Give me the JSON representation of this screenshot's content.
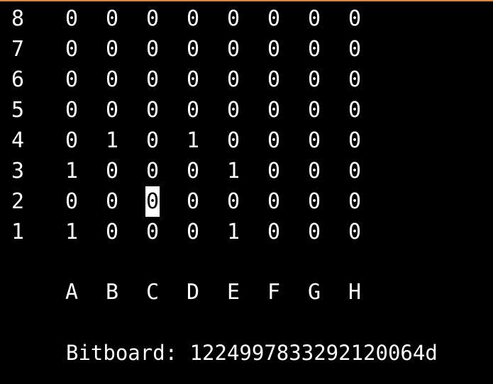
{
  "terminal": {
    "rows": [
      {
        "rank": "8",
        "cells": [
          "0",
          "0",
          "0",
          "0",
          "0",
          "0",
          "0",
          "0"
        ]
      },
      {
        "rank": "7",
        "cells": [
          "0",
          "0",
          "0",
          "0",
          "0",
          "0",
          "0",
          "0"
        ]
      },
      {
        "rank": "6",
        "cells": [
          "0",
          "0",
          "0",
          "0",
          "0",
          "0",
          "0",
          "0"
        ]
      },
      {
        "rank": "5",
        "cells": [
          "0",
          "0",
          "0",
          "0",
          "0",
          "0",
          "0",
          "0"
        ]
      },
      {
        "rank": "4",
        "cells": [
          "0",
          "1",
          "0",
          "1",
          "0",
          "0",
          "0",
          "0"
        ]
      },
      {
        "rank": "3",
        "cells": [
          "1",
          "0",
          "0",
          "0",
          "1",
          "0",
          "0",
          "0"
        ]
      },
      {
        "rank": "2",
        "cells": [
          "0",
          "0",
          "0",
          "0",
          "0",
          "0",
          "0",
          "0"
        ]
      },
      {
        "rank": "1",
        "cells": [
          "1",
          "0",
          "0",
          "0",
          "1",
          "0",
          "0",
          "0"
        ]
      }
    ],
    "files": [
      "A",
      "B",
      "C",
      "D",
      "E",
      "F",
      "G",
      "H"
    ],
    "bitboard_line": "Bitboard: 1224997833292120064d",
    "cursor": {
      "rank": "2",
      "file": "C"
    },
    "colors": {
      "background": "#000000",
      "foreground": "#ffffff",
      "top_border": "#d9883c"
    }
  }
}
